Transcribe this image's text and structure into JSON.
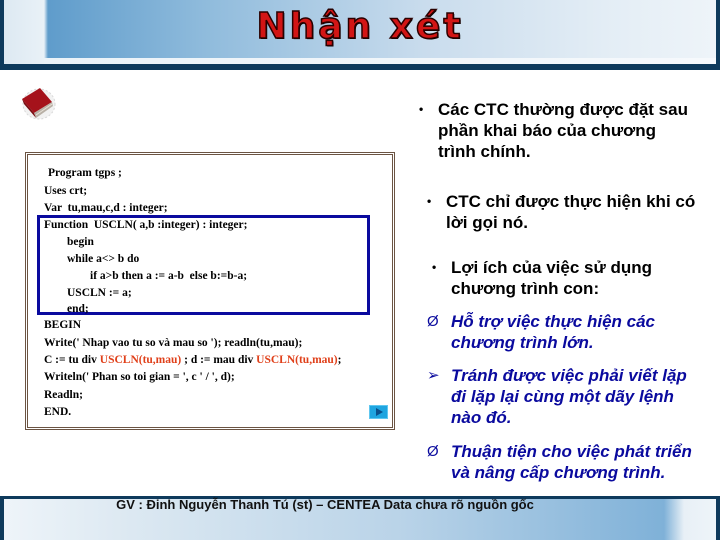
{
  "slide": {
    "title": "Nhận xét",
    "colors": {
      "title_red": "#d21515",
      "frame_navy": "#0e3a5c",
      "highlight_blue": "#0a0a9e",
      "code_highlight": "#e0401a",
      "next_button": "#1fa5e0"
    }
  },
  "code": {
    "lines": [
      {
        "text": "Program tgps ;"
      },
      {
        "text": "Uses crt;"
      },
      {
        "text": "Var  tu,mau,c,d : integer;"
      },
      {
        "text": "Function  USCLN( a,b :integer) : integer;"
      },
      {
        "text": "        begin"
      },
      {
        "text": "        while a<> b do"
      },
      {
        "text": "                if a>b then a := a-b  else b:=b-a;"
      },
      {
        "text": "        USCLN := a;"
      },
      {
        "text": "        end;"
      },
      {
        "text": "BEGIN"
      },
      {
        "text": "Write(' Nhap vao tu so và mau so '); readln(tu,mau);"
      },
      {
        "parts": [
          "C := tu div ",
          "USCLN(tu,mau)",
          " ; d := mau div ",
          "USCLN(tu,mau)",
          ";"
        ]
      },
      {
        "text": "Writeln(' Phan so toi gian = ', c ' / ', d);"
      },
      {
        "text": "Readln;"
      },
      {
        "text": "END."
      }
    ],
    "next_icon": "play-triangle-icon"
  },
  "bullets": [
    {
      "mark": "•",
      "lines": [
        "Các CTC thường được đặt sau",
        "phần khai báo của chương",
        "trình chính."
      ]
    },
    {
      "mark": "•",
      "lines": [
        "CTC chỉ được thực hiện khi có",
        "lời gọi nó."
      ]
    },
    {
      "mark": "•",
      "lines": [
        "Lợi ích của việc sử dụng",
        "chương trình con:"
      ]
    }
  ],
  "sub_bullets": [
    {
      "mark": "Ø",
      "lines": [
        "Hỗ trợ việc thực hiện các",
        "chương trình lớn."
      ]
    },
    {
      "mark": "➢",
      "lines": [
        "Tránh được việc phải viết lặp",
        "đi lặp lại cùng một dãy lệnh",
        "nào đó."
      ]
    },
    {
      "mark": "Ø",
      "lines": [
        "Thuận tiện cho việc phát triển",
        "và nâng cấp chương  trình."
      ]
    }
  ],
  "footer": {
    "text": "GV : Đinh Nguyễn Thanh Tú (st) – CENTEA Data chưa rõ nguồn gốc"
  }
}
